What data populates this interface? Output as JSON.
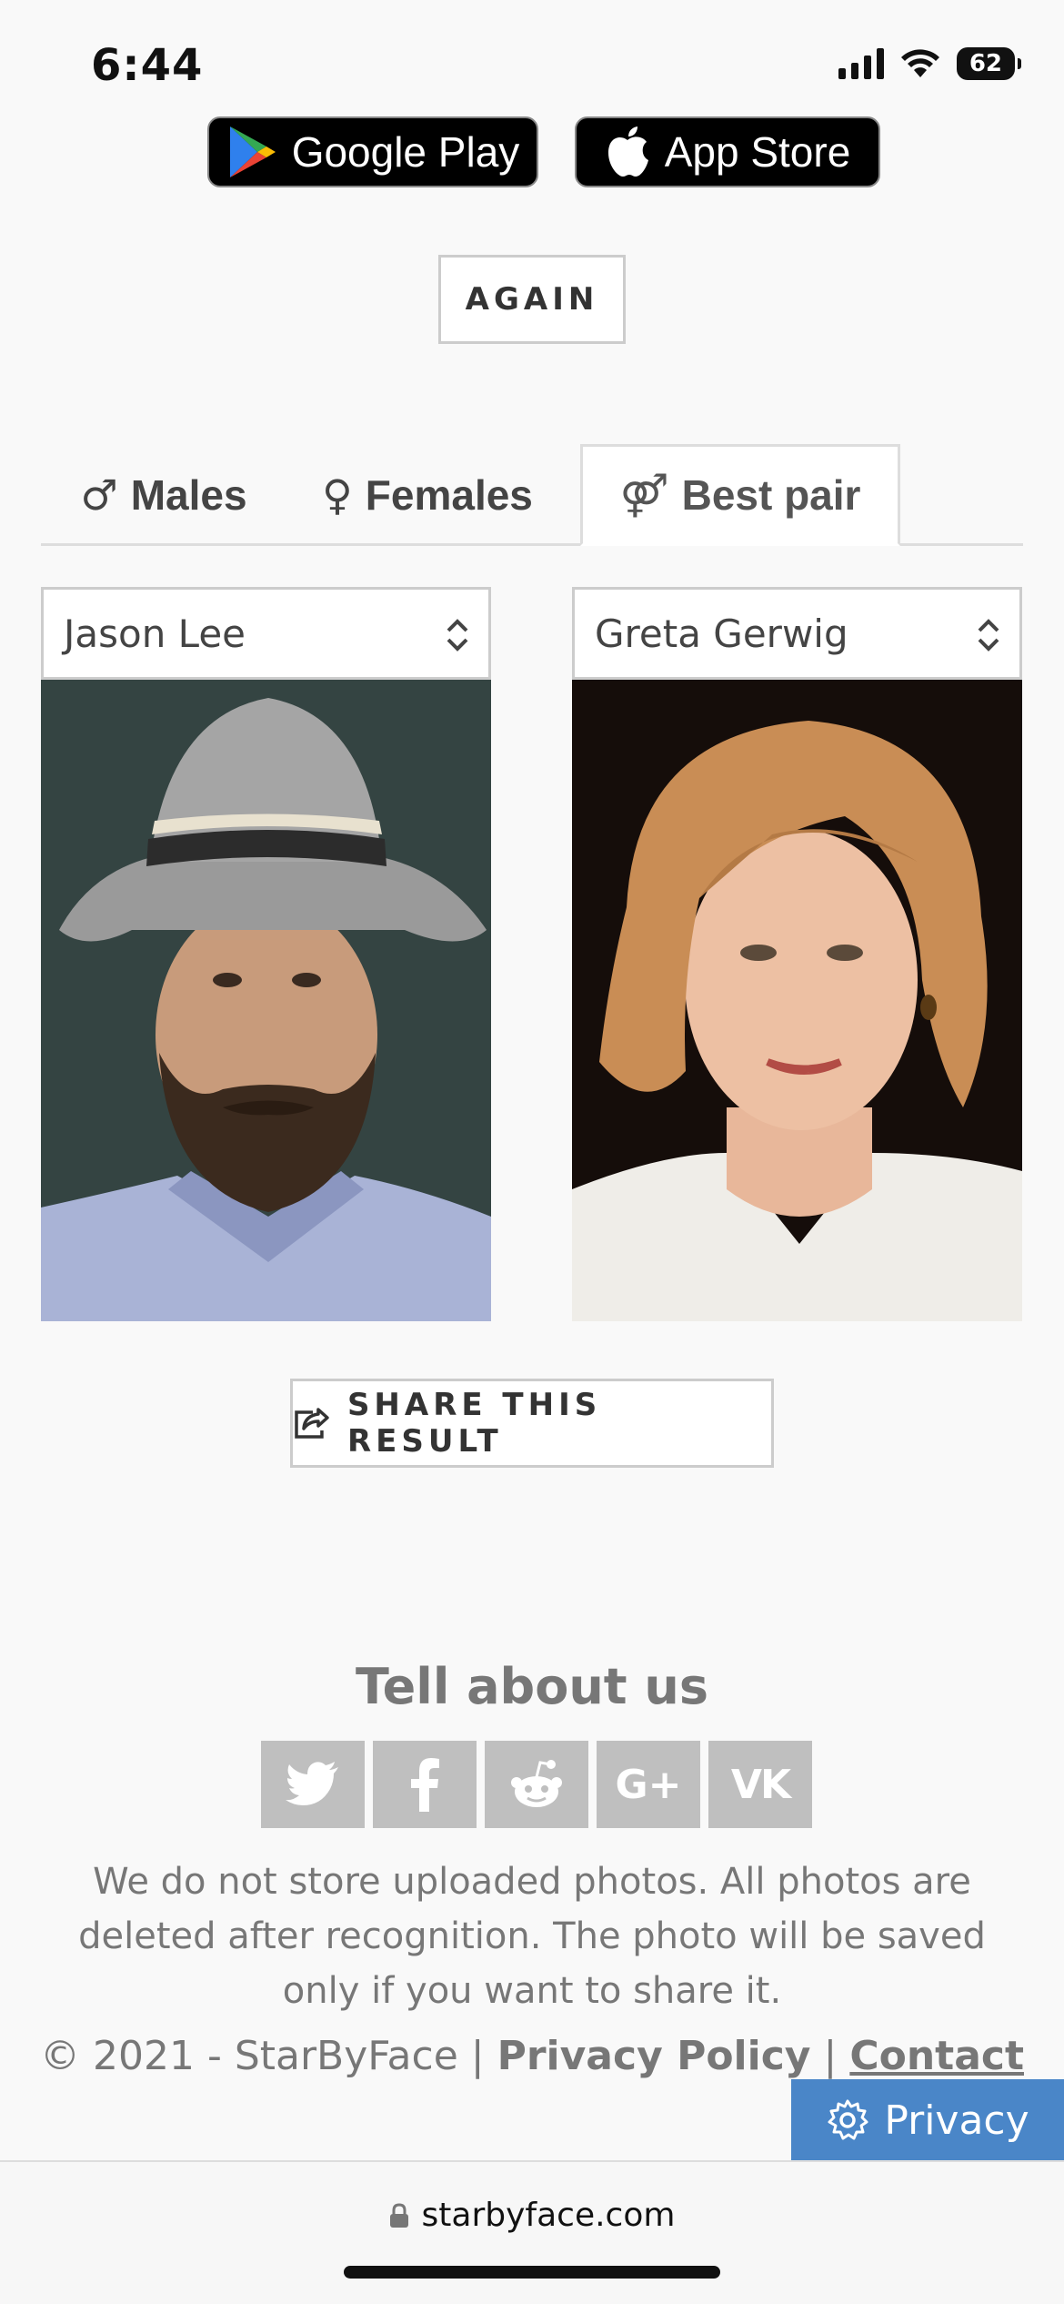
{
  "status": {
    "time": "6:44",
    "battery": "62"
  },
  "stores": {
    "google": "Google Play",
    "apple": "App Store"
  },
  "buttons": {
    "again": "AGAIN",
    "share": "SHARE THIS RESULT"
  },
  "tabs": [
    {
      "symbol": "♂",
      "label": "Males"
    },
    {
      "symbol": "♀",
      "label": "Females"
    },
    {
      "symbol": "⚤",
      "label": "Best pair"
    }
  ],
  "pair": {
    "male": "Jason Lee",
    "female": "Greta Gerwig"
  },
  "footer": {
    "heading": "Tell about us",
    "social": [
      "twitter-icon",
      "facebook-icon",
      "reddit-icon",
      "google-plus-icon",
      "vk-icon"
    ],
    "google_plus_label": "G+",
    "vk_label": "VK",
    "disclaimer": "We do not store uploaded photos. All photos are deleted after recognition. The photo will be saved only if you want to share it.",
    "copyright": "© 2021 - StarByFace",
    "separator": "|",
    "privacy_policy": "Privacy Policy",
    "contact": "Contact",
    "privacy_button": "Privacy"
  },
  "browser": {
    "url": "starbyface.com"
  },
  "colors": {
    "privacy_button": "#4a86c8",
    "social_tile": "#bfbfbf",
    "text_muted": "#777777"
  }
}
